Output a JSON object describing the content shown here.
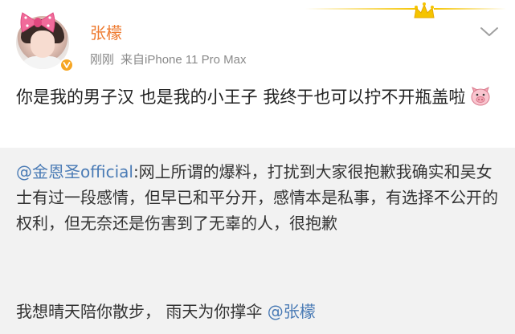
{
  "post": {
    "username": "张檬",
    "time": "刚刚",
    "source": "来自iPhone 11 Pro Max",
    "text": "你是我的男子汉  也是我的小王子  我终于也可以拧不开瓶盖啦",
    "emoji": "pig-face"
  },
  "repost": {
    "mention": "@金恩圣official",
    "text": ":网上所谓的爆料，打扰到大家很抱歉我确实和吴女士有过一段感情，但早已和平分开，感情本是私事，有选择不公开的权利，但无奈还是伤害到了无辜的人，很抱歉",
    "comment_text": "我想晴天陪你散步，  雨天为你撑伞 ",
    "comment_mention": "@张檬"
  },
  "colors": {
    "username": "#ee7a2f",
    "mention": "#4a7bb5",
    "meta": "#8a8a8a",
    "repost_bg": "#f2f2f2",
    "badge": "#f6a623",
    "decor": "#f5c400"
  }
}
